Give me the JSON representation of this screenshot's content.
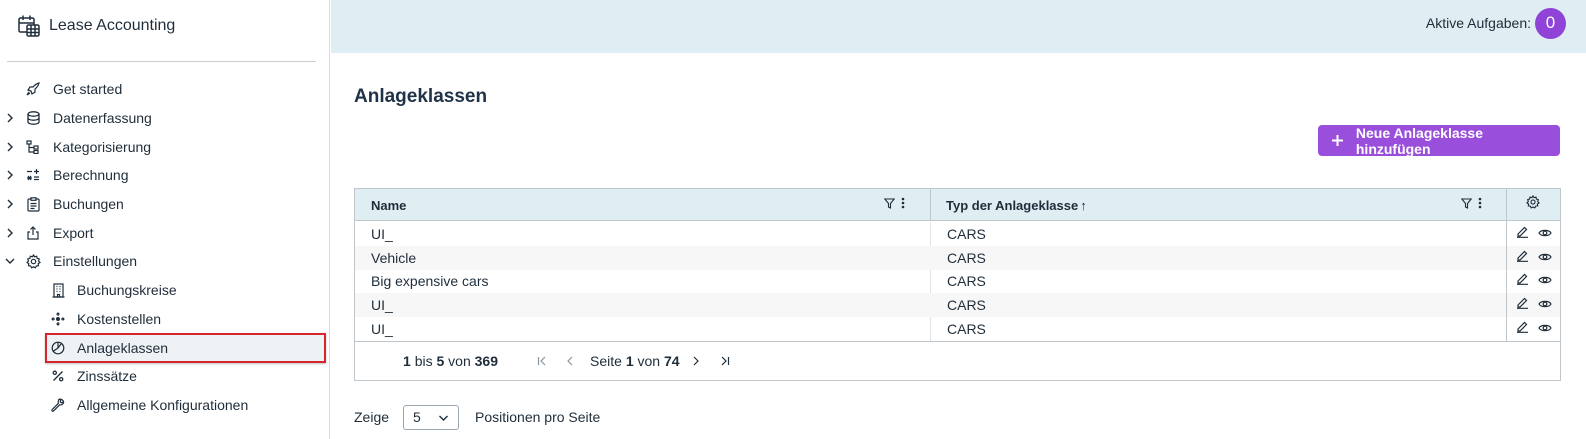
{
  "app": {
    "title": "Lease Accounting"
  },
  "sidebar": {
    "items": [
      {
        "label": "Get started",
        "icon": "rocket-icon",
        "expandable": false
      },
      {
        "label": "Datenerfassung",
        "icon": "database-icon",
        "expandable": true
      },
      {
        "label": "Kategorisierung",
        "icon": "hierarchy-icon",
        "expandable": true
      },
      {
        "label": "Berechnung",
        "icon": "calculator-icon",
        "expandable": true
      },
      {
        "label": "Buchungen",
        "icon": "clipboard-icon",
        "expandable": true
      },
      {
        "label": "Export",
        "icon": "export-icon",
        "expandable": true
      },
      {
        "label": "Einstellungen",
        "icon": "gear-icon",
        "expandable": true,
        "expanded": true
      }
    ],
    "subitems": [
      {
        "label": "Buchungskreise",
        "icon": "building-icon"
      },
      {
        "label": "Kostenstellen",
        "icon": "cost-center-icon"
      },
      {
        "label": "Anlageklassen",
        "icon": "pie-chart-icon",
        "active": true
      },
      {
        "label": "Zinssätze",
        "icon": "percent-icon"
      },
      {
        "label": "Allgemeine Konfigurationen",
        "icon": "wrench-icon"
      }
    ]
  },
  "topbar": {
    "tasks_label": "Aktive Aufgaben:",
    "tasks_count": "0"
  },
  "main": {
    "title": "Anlageklassen",
    "add_button": "Neue Anlageklasse hinzufügen",
    "table": {
      "columns": [
        "Name",
        "Typ der Anlageklasse"
      ],
      "sort": {
        "column": "Typ der Anlageklasse",
        "direction": "asc",
        "indicator": "↑"
      },
      "rows": [
        {
          "name": "UI_",
          "typ": "CARS"
        },
        {
          "name": "Vehicle",
          "typ": "CARS"
        },
        {
          "name": "Big expensive cars",
          "typ": "CARS"
        },
        {
          "name": "UI_",
          "typ": "CARS"
        },
        {
          "name": "UI_",
          "typ": "CARS"
        }
      ]
    },
    "pager": {
      "from": "1",
      "bis": "bis",
      "to": "5",
      "von": "von",
      "total": "369",
      "seite": "Seite",
      "page": "1",
      "von2": "von",
      "pages": "74"
    },
    "page_size": {
      "prefix": "Zeige",
      "value": "5",
      "suffix": "Positionen pro Seite"
    }
  },
  "colors": {
    "accent": "#9a4fdc",
    "badge": "#8f44d7",
    "header_bg": "#dfeef2",
    "highlight_border": "#d6262b"
  }
}
